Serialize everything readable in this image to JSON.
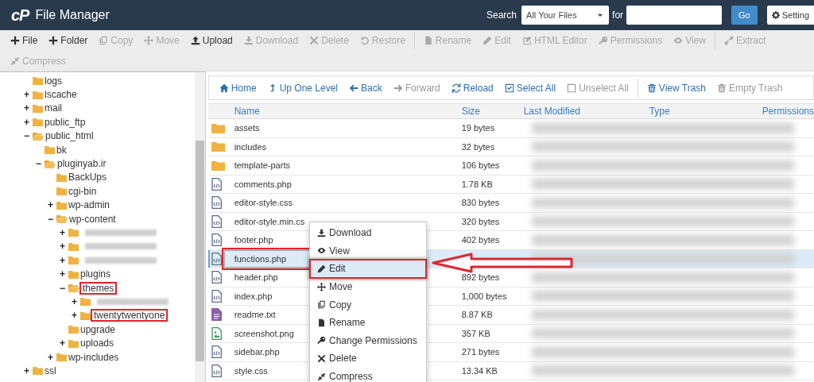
{
  "header": {
    "logo": "cP",
    "title": "File Manager",
    "search_label": "Search",
    "scope": "All Your Files",
    "for_label": "for",
    "go": "Go",
    "settings": "Setting"
  },
  "toolbar": {
    "groups": [
      [
        {
          "label": "File",
          "disabled": false
        },
        {
          "label": "Folder",
          "disabled": false
        },
        {
          "label": "Copy",
          "disabled": true
        },
        {
          "label": "Move",
          "disabled": true
        },
        {
          "label": "Upload",
          "disabled": false
        },
        {
          "label": "Download",
          "disabled": true
        },
        {
          "label": "Delete",
          "disabled": true
        },
        {
          "label": "Restore",
          "disabled": true
        }
      ],
      [
        {
          "label": "Rename",
          "disabled": true
        },
        {
          "label": "Edit",
          "disabled": true
        },
        {
          "label": "HTML Editor",
          "disabled": true
        },
        {
          "label": "Permissions",
          "disabled": true
        },
        {
          "label": "View",
          "disabled": true
        }
      ],
      [
        {
          "label": "Extract",
          "disabled": true
        },
        {
          "label": "Compress",
          "disabled": true
        }
      ]
    ]
  },
  "tree": [
    {
      "label": "logs"
    },
    {
      "label": "lscache",
      "toggle": "+",
      "expanded": false
    },
    {
      "label": "mail",
      "toggle": "+",
      "expanded": false
    },
    {
      "label": "public_ftp",
      "toggle": "+",
      "expanded": false
    },
    {
      "label": "public_html",
      "toggle": "−",
      "expanded": true,
      "children": [
        {
          "label": "bk"
        },
        {
          "label": "pluginyab.ir",
          "toggle": "−",
          "expanded": true,
          "children": [
            {
              "label": "BackUps"
            },
            {
              "label": "cgi-bin"
            },
            {
              "label": "wp-admin",
              "toggle": "+",
              "expanded": false
            },
            {
              "label": "wp-content",
              "toggle": "−",
              "expanded": true,
              "children": [
                {
                  "toggle": "+",
                  "expanded": false,
                  "blurred": true
                },
                {
                  "toggle": "+",
                  "expanded": false,
                  "blurred": true
                },
                {
                  "toggle": "+",
                  "expanded": false,
                  "blurred": true
                },
                {
                  "label": "plugins",
                  "toggle": "+",
                  "expanded": false
                },
                {
                  "label": "themes",
                  "toggle": "−",
                  "expanded": true,
                  "highlighted": true,
                  "children": [
                    {
                      "toggle": "+",
                      "expanded": false,
                      "blurred": true
                    },
                    {
                      "label": "twentytwentyone",
                      "toggle": "+",
                      "expanded": false,
                      "highlighted": true
                    }
                  ]
                },
                {
                  "label": "upgrade"
                },
                {
                  "label": "uploads",
                  "toggle": "+",
                  "expanded": false
                }
              ]
            },
            {
              "label": "wp-includes",
              "toggle": "+",
              "expanded": false
            }
          ]
        }
      ]
    },
    {
      "label": "ssl",
      "toggle": "+",
      "expanded": false
    }
  ],
  "nav": {
    "groups": [
      [
        {
          "label": "Home",
          "disabled": false
        },
        {
          "label": "Up One Level",
          "disabled": false
        },
        {
          "label": "Back",
          "disabled": false
        },
        {
          "label": "Forward",
          "disabled": true
        },
        {
          "label": "Reload",
          "disabled": false
        },
        {
          "label": "Select All",
          "disabled": false
        },
        {
          "label": "Unselect All",
          "disabled": true
        }
      ],
      [
        {
          "label": "View Trash",
          "disabled": false
        },
        {
          "label": "Empty Trash",
          "disabled": true
        }
      ]
    ]
  },
  "table": {
    "columns": [
      "Name",
      "Size",
      "Last Modified",
      "Type",
      "Permissions"
    ],
    "rows": [
      {
        "kind": "folder",
        "name": "assets",
        "size": "19 bytes",
        "selected": false,
        "highlighted": false
      },
      {
        "kind": "folder",
        "name": "includes",
        "size": "32 bytes",
        "selected": false,
        "highlighted": false
      },
      {
        "kind": "folder",
        "name": "template-parts",
        "size": "106 bytes",
        "selected": false,
        "highlighted": false
      },
      {
        "kind": "code",
        "name": "comments.php",
        "size": "1.78 KB",
        "selected": false,
        "highlighted": false
      },
      {
        "kind": "code",
        "name": "editor-style.css",
        "size": "830 bytes",
        "selected": false,
        "highlighted": false
      },
      {
        "kind": "code",
        "name": "editor-style.min.cs",
        "size": "320 bytes",
        "selected": false,
        "highlighted": false
      },
      {
        "kind": "code",
        "name": "footer.php",
        "size": "402 bytes",
        "selected": false,
        "highlighted": false
      },
      {
        "kind": "code",
        "name": "functions.php",
        "selected": true,
        "highlighted": true
      },
      {
        "kind": "code",
        "name": "header.php",
        "size": "892 bytes",
        "selected": false,
        "highlighted": false
      },
      {
        "kind": "code",
        "name": "index.php",
        "size": "1,000 bytes",
        "selected": false,
        "highlighted": false
      },
      {
        "kind": "text",
        "name": "readme.txt",
        "size": "8.87 KB",
        "selected": false,
        "highlighted": false
      },
      {
        "kind": "image",
        "name": "screenshot.png",
        "size": "357 KB",
        "selected": false,
        "highlighted": false
      },
      {
        "kind": "code",
        "name": "sidebar.php",
        "size": "271 bytes",
        "selected": false,
        "highlighted": false
      },
      {
        "kind": "code",
        "name": "style.css",
        "size": "13.34 KB",
        "selected": false,
        "highlighted": false
      }
    ]
  },
  "context_menu": {
    "items": [
      {
        "label": "Download",
        "selected": false,
        "highlighted": false
      },
      {
        "label": "View",
        "selected": false,
        "highlighted": false
      },
      {
        "label": "Edit",
        "selected": true,
        "highlighted": true
      },
      {
        "label": "Move",
        "selected": false,
        "highlighted": false
      },
      {
        "label": "Copy",
        "selected": false,
        "highlighted": false
      },
      {
        "label": "Rename",
        "selected": false,
        "highlighted": false
      },
      {
        "label": "Change Permissions",
        "selected": false,
        "highlighted": false
      },
      {
        "label": "Delete",
        "selected": false,
        "highlighted": false
      },
      {
        "label": "Compress",
        "selected": false,
        "highlighted": false
      }
    ]
  }
}
